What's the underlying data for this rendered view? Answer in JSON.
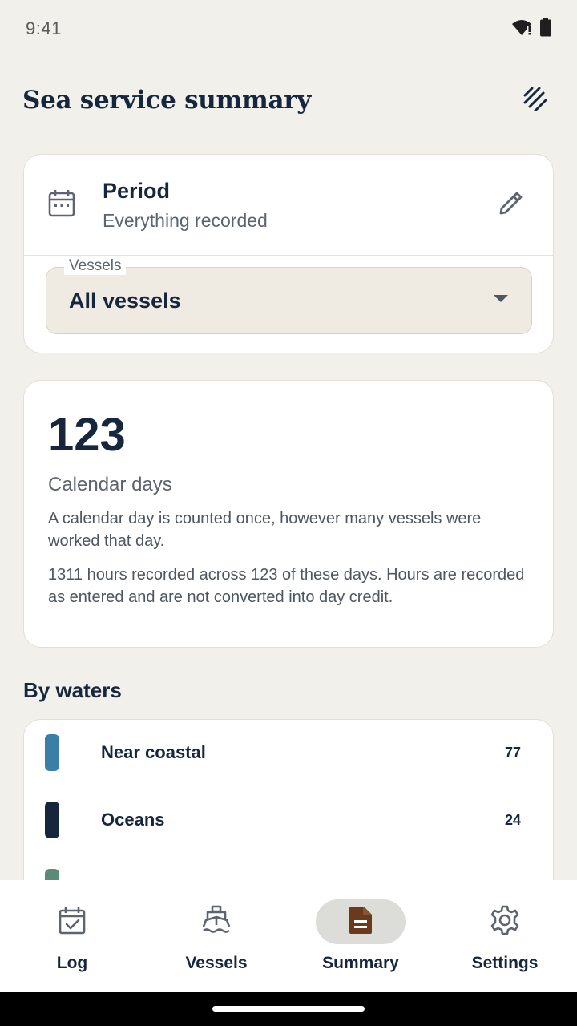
{
  "status_bar": {
    "time": "9:41"
  },
  "header": {
    "title": "Sea service summary"
  },
  "period": {
    "title": "Period",
    "subtitle": "Everything recorded"
  },
  "vessel_filter": {
    "label": "Vessels",
    "selected": "All vessels"
  },
  "days_summary": {
    "count": "123",
    "label": "Calendar days",
    "description": "A calendar day is counted once, however many vessels were worked that day.",
    "hours_note": "1311 hours recorded across 123 of these days. Hours are recorded as entered and are not converted into day credit."
  },
  "by_waters": {
    "heading": "By waters",
    "items": [
      {
        "name": "Near coastal",
        "days": "77",
        "color": "#3b7ea8"
      },
      {
        "name": "Oceans",
        "days": "24",
        "color": "#15263d"
      },
      {
        "name": "",
        "days": "",
        "color": "#5a8a78"
      }
    ]
  },
  "nav": {
    "items": [
      {
        "label": "Log",
        "icon": "calendar-check-icon"
      },
      {
        "label": "Vessels",
        "icon": "ship-icon"
      },
      {
        "label": "Summary",
        "icon": "document-icon",
        "active": true
      },
      {
        "label": "Settings",
        "icon": "gear-icon"
      }
    ]
  },
  "colors": {
    "accent": "#15263d",
    "summary_icon": "#6b3a1c",
    "background": "#f2f0eb"
  }
}
